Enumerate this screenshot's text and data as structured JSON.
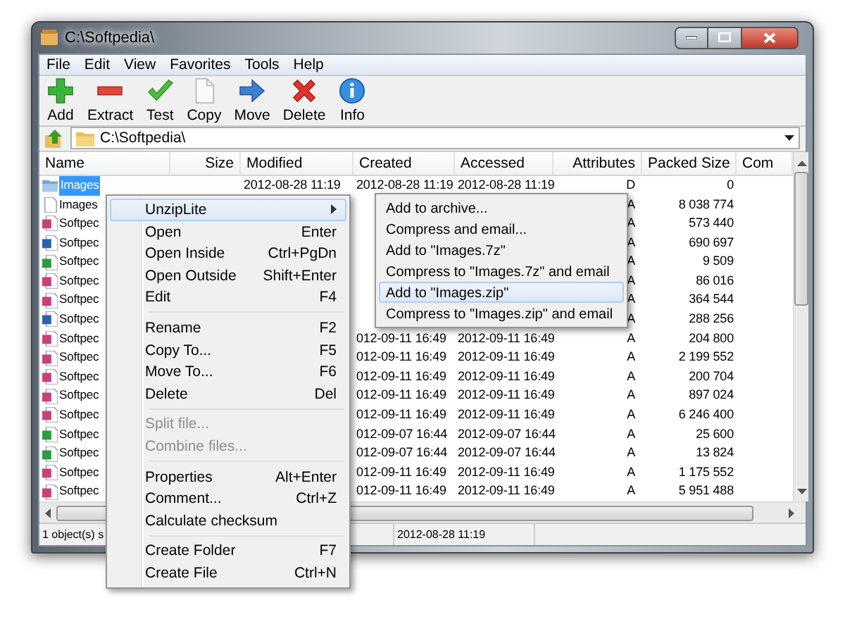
{
  "window": {
    "title": "C:\\Softpedia\\"
  },
  "menu_bar": [
    "File",
    "Edit",
    "View",
    "Favorites",
    "Tools",
    "Help"
  ],
  "toolbar": [
    {
      "label": "Add",
      "kind": "add"
    },
    {
      "label": "Extract",
      "kind": "extract"
    },
    {
      "label": "Test",
      "kind": "test"
    },
    {
      "label": "Copy",
      "kind": "copy"
    },
    {
      "label": "Move",
      "kind": "move"
    },
    {
      "label": "Delete",
      "kind": "delete"
    },
    {
      "label": "Info",
      "kind": "info"
    }
  ],
  "address": {
    "path": "C:\\Softpedia\\"
  },
  "table": {
    "columns": [
      "Name",
      "Size",
      "Modified",
      "Created",
      "Accessed",
      "Attributes",
      "Packed Size",
      "Com"
    ],
    "rows": [
      {
        "kind": "folder",
        "name": "Images",
        "selected": true,
        "modified": "2012-08-28 11:19",
        "created": "2012-08-28 11:19",
        "accessed": "2012-08-28 11:19",
        "attributes": "D",
        "packed_size": "0"
      },
      {
        "kind": "file",
        "name": "Images",
        "selected": false,
        "attributes": "A",
        "packed_size": "8 038 774"
      },
      {
        "kind": "presentation",
        "name": "Softpec",
        "selected": false,
        "attributes": "A",
        "packed_size": "573 440"
      },
      {
        "kind": "document",
        "name": "Softpec",
        "selected": false,
        "attributes": "A",
        "packed_size": "690 697"
      },
      {
        "kind": "spreadsheet",
        "name": "Softpec",
        "selected": false,
        "attributes": "A",
        "packed_size": "9 509"
      },
      {
        "kind": "presentation",
        "name": "Softpec",
        "selected": false,
        "attributes": "A",
        "packed_size": "86 016"
      },
      {
        "kind": "presentation",
        "name": "Softpec",
        "selected": false,
        "attributes": "A",
        "packed_size": "364 544"
      },
      {
        "kind": "document",
        "name": "Softpec",
        "selected": false,
        "attributes": "A",
        "packed_size": "288 256"
      },
      {
        "kind": "presentation",
        "name": "Softpec",
        "selected": false,
        "created": "012-09-11 16:49",
        "accessed": "2012-09-11 16:49",
        "attributes": "A",
        "packed_size": "204 800"
      },
      {
        "kind": "presentation",
        "name": "Softpec",
        "selected": false,
        "created": "012-09-11 16:49",
        "accessed": "2012-09-11 16:49",
        "attributes": "A",
        "packed_size": "2 199 552"
      },
      {
        "kind": "presentation",
        "name": "Softpec",
        "selected": false,
        "created": "012-09-11 16:49",
        "accessed": "2012-09-11 16:49",
        "attributes": "A",
        "packed_size": "200 704"
      },
      {
        "kind": "presentation",
        "name": "Softpec",
        "selected": false,
        "created": "012-09-11 16:49",
        "accessed": "2012-09-11 16:49",
        "attributes": "A",
        "packed_size": "897 024"
      },
      {
        "kind": "presentation",
        "name": "Softpec",
        "selected": false,
        "created": "012-09-11 16:49",
        "accessed": "2012-09-11 16:49",
        "attributes": "A",
        "packed_size": "6 246 400"
      },
      {
        "kind": "spreadsheet",
        "name": "Softpec",
        "selected": false,
        "created": "012-09-07 16:44",
        "accessed": "2012-09-07 16:44",
        "attributes": "A",
        "packed_size": "25 600"
      },
      {
        "kind": "spreadsheet",
        "name": "Softpec",
        "selected": false,
        "created": "012-09-07 16:44",
        "accessed": "2012-09-07 16:44",
        "attributes": "A",
        "packed_size": "13 824"
      },
      {
        "kind": "presentation",
        "name": "Softpec",
        "selected": false,
        "created": "012-09-11 16:49",
        "accessed": "2012-09-11 16:49",
        "attributes": "A",
        "packed_size": "1 175 552"
      },
      {
        "kind": "presentation",
        "name": "Softpec",
        "selected": false,
        "created": "012-09-11 16:49",
        "accessed": "2012-09-11 16:49",
        "attributes": "A",
        "packed_size": "5 951 488"
      }
    ]
  },
  "status_bar": [
    "1 object(s) s",
    "2012-08-28 11:19"
  ],
  "context_menu": {
    "items": [
      {
        "kind": "submenu",
        "label": "UnzipLite",
        "selected": true,
        "disabled": false
      },
      {
        "kind": "item",
        "label": "Open",
        "shortcut": "Enter",
        "selected": false,
        "disabled": false
      },
      {
        "kind": "item",
        "label": "Open Inside",
        "shortcut": "Ctrl+PgDn",
        "selected": false,
        "disabled": false
      },
      {
        "kind": "item",
        "label": "Open Outside",
        "shortcut": "Shift+Enter",
        "selected": false,
        "disabled": false
      },
      {
        "kind": "item",
        "label": "Edit",
        "shortcut": "F4",
        "selected": false,
        "disabled": false
      },
      {
        "kind": "separator"
      },
      {
        "kind": "item",
        "label": "Rename",
        "shortcut": "F2",
        "selected": false,
        "disabled": false
      },
      {
        "kind": "item",
        "label": "Copy To...",
        "shortcut": "F5",
        "selected": false,
        "disabled": false
      },
      {
        "kind": "item",
        "label": "Move To...",
        "shortcut": "F6",
        "selected": false,
        "disabled": false
      },
      {
        "kind": "item",
        "label": "Delete",
        "shortcut": "Del",
        "selected": false,
        "disabled": false
      },
      {
        "kind": "separator"
      },
      {
        "kind": "item",
        "label": "Split file...",
        "selected": false,
        "disabled": true
      },
      {
        "kind": "item",
        "label": "Combine files...",
        "selected": false,
        "disabled": true
      },
      {
        "kind": "separator"
      },
      {
        "kind": "item",
        "label": "Properties",
        "shortcut": "Alt+Enter",
        "selected": false,
        "disabled": false
      },
      {
        "kind": "item",
        "label": "Comment...",
        "shortcut": "Ctrl+Z",
        "selected": false,
        "disabled": false
      },
      {
        "kind": "item",
        "label": "Calculate checksum",
        "selected": false,
        "disabled": false
      },
      {
        "kind": "separator"
      },
      {
        "kind": "item",
        "label": "Create Folder",
        "shortcut": "F7",
        "selected": false,
        "disabled": false
      },
      {
        "kind": "item",
        "label": "Create File",
        "shortcut": "Ctrl+N",
        "selected": false,
        "disabled": false
      }
    ]
  },
  "submenu": {
    "items": [
      {
        "label": "Add to archive...",
        "selected": false
      },
      {
        "label": "Compress and email...",
        "selected": false
      },
      {
        "label": "Add to \"Images.7z\"",
        "selected": false
      },
      {
        "label": "Compress to \"Images.7z\" and email",
        "selected": false
      },
      {
        "label": "Add to \"Images.zip\"",
        "selected": true
      },
      {
        "label": "Compress to \"Images.zip\" and email",
        "selected": false
      }
    ]
  }
}
